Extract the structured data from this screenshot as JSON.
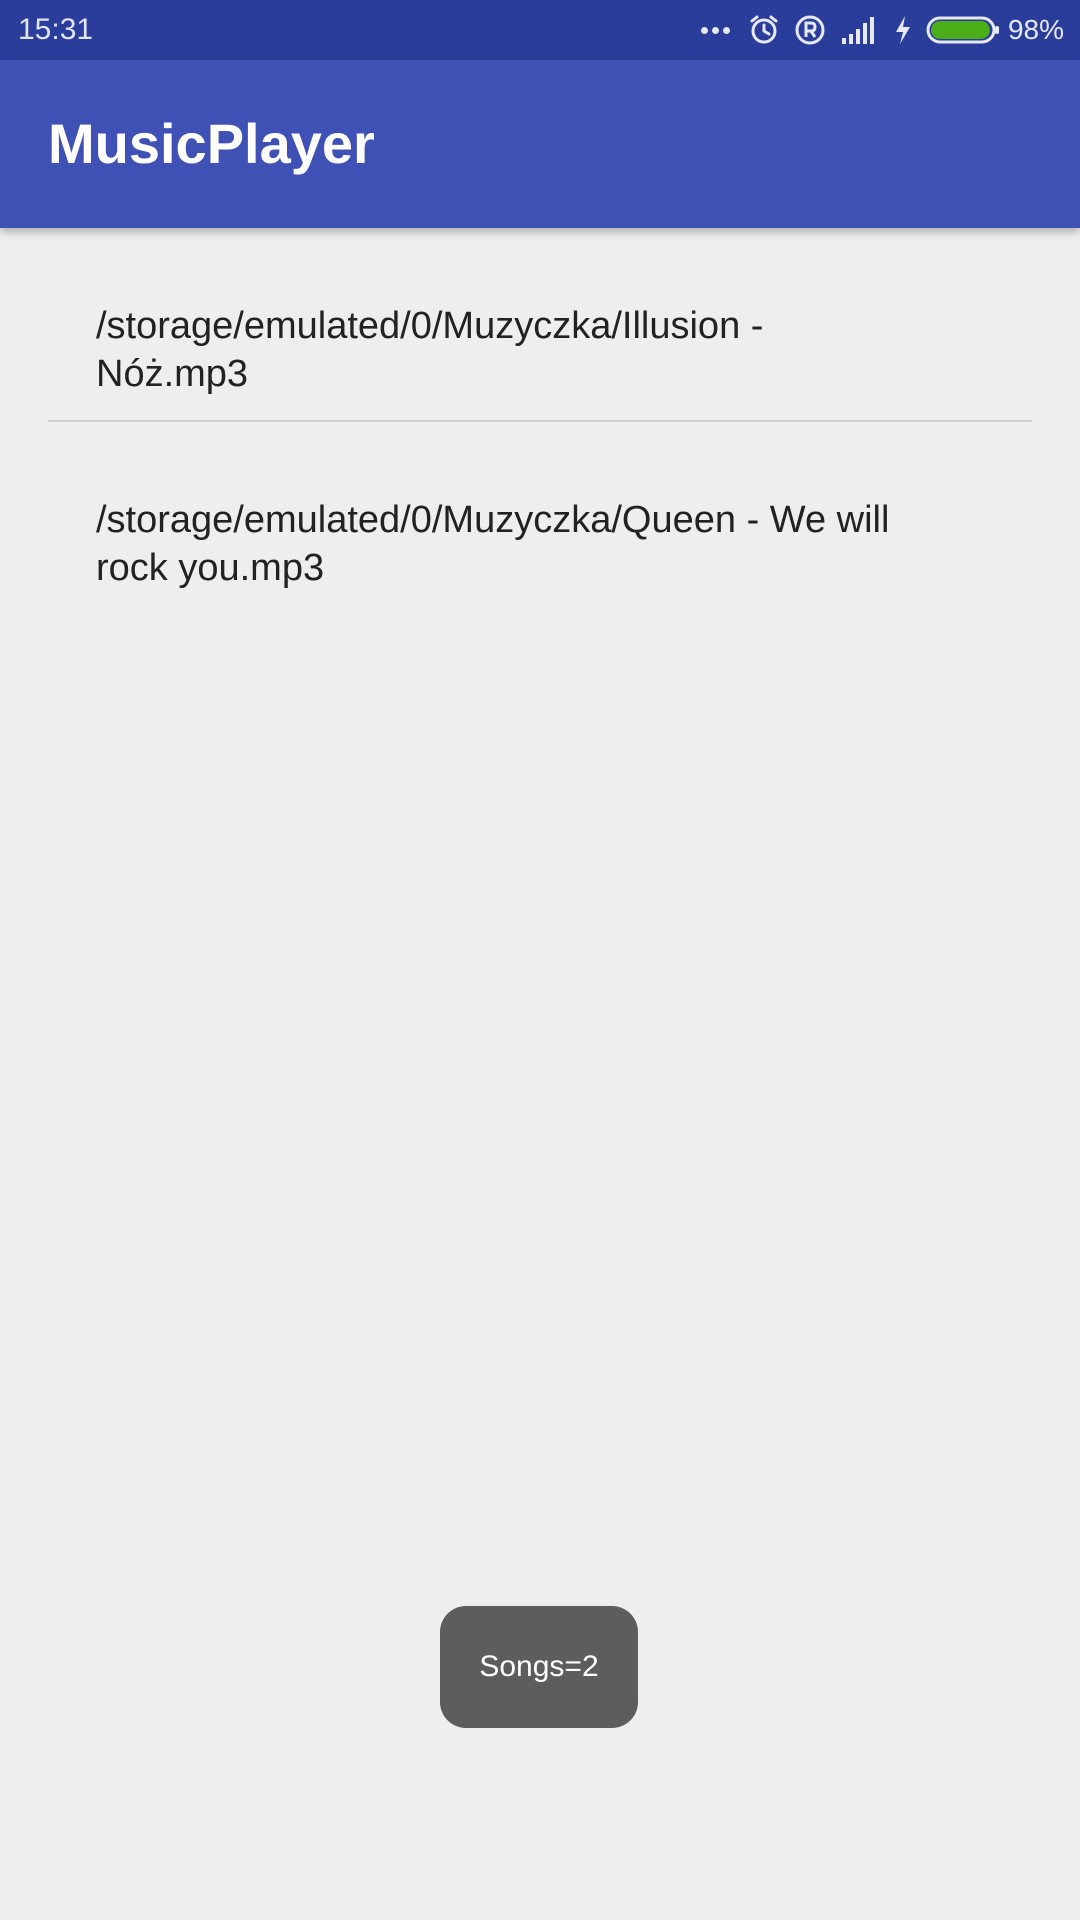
{
  "status_bar": {
    "time": "15:31",
    "icons": [
      "more-dots-icon",
      "alarm-icon",
      "registered-icon",
      "signal-icon",
      "charging-icon",
      "battery-icon"
    ],
    "battery_percent": "98%",
    "battery_level": 0.98,
    "battery_color": "#4caf1a",
    "background": "#2b3d9b"
  },
  "app_bar": {
    "title": "MusicPlayer",
    "background": "#3f51b5"
  },
  "songs": [
    {
      "path_line1": "/storage/emulated/0/Muzyczka/Illusion -",
      "path_line2": "Nóż.mp3"
    },
    {
      "path_line1": "/storage/emulated/0/Muzyczka/Queen - We will",
      "path_line2": "rock you.mp3"
    }
  ],
  "toast": {
    "text": "Songs=2"
  }
}
